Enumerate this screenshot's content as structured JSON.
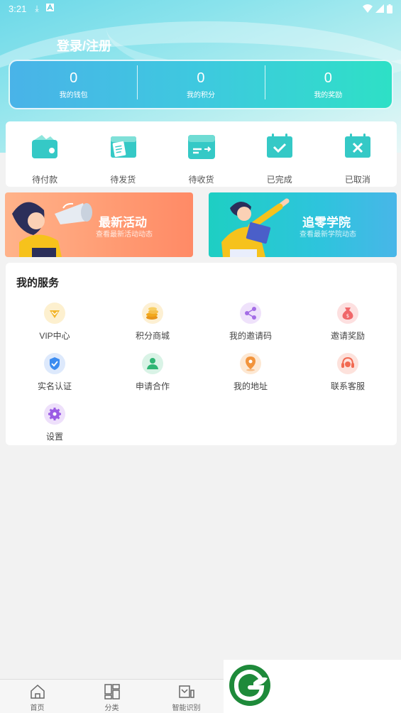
{
  "status_bar": {
    "time": "3:21"
  },
  "header": {
    "title": "登录/注册"
  },
  "stats": [
    {
      "value": "0",
      "label": "我的钱包"
    },
    {
      "value": "0",
      "label": "我的积分"
    },
    {
      "value": "0",
      "label": "我的奖励"
    }
  ],
  "orders": [
    {
      "label": "待付款",
      "icon": "wallet-icon"
    },
    {
      "label": "待发货",
      "icon": "package-icon"
    },
    {
      "label": "待收货",
      "icon": "delivery-box-icon"
    },
    {
      "label": "已完成",
      "icon": "calendar-check-icon"
    },
    {
      "label": "已取消",
      "icon": "calendar-x-icon"
    }
  ],
  "banners": [
    {
      "title": "最新活动",
      "subtitle": "查看最新活动动态"
    },
    {
      "title": "追零学院",
      "subtitle": "查看最新学院动态"
    }
  ],
  "services": {
    "title": "我的服务",
    "items": [
      {
        "label": "VIP中心",
        "icon": "vip-diamond-icon",
        "color": "#f3b62b"
      },
      {
        "label": "积分商城",
        "icon": "coins-icon",
        "color": "#f2a81c"
      },
      {
        "label": "我的邀请码",
        "icon": "share-icon",
        "color": "#a46de6"
      },
      {
        "label": "邀请奖励",
        "icon": "money-bag-icon",
        "color": "#f0676a"
      },
      {
        "label": "实名认证",
        "icon": "verified-shield-icon",
        "color": "#3c8cf0"
      },
      {
        "label": "申请合作",
        "icon": "user-icon",
        "color": "#2fb574"
      },
      {
        "label": "我的地址",
        "icon": "location-pin-icon",
        "color": "#f2943c"
      },
      {
        "label": "联系客服",
        "icon": "headset-icon",
        "color": "#f16a52"
      },
      {
        "label": "设置",
        "icon": "gear-icon",
        "color": "#9b5ce4"
      }
    ]
  },
  "bottom_nav": [
    {
      "label": "首页",
      "icon": "home-icon"
    },
    {
      "label": "分类",
      "icon": "category-icon"
    },
    {
      "label": "智能识别",
      "icon": "scan-icon"
    }
  ]
}
